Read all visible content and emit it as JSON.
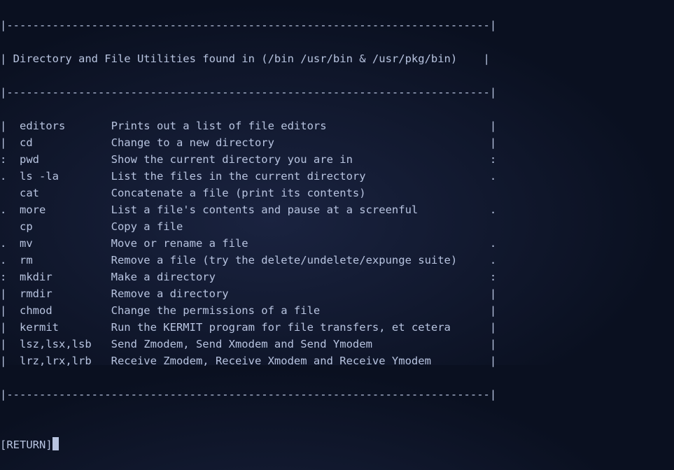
{
  "border_top": "|--------------------------------------------------------------------------|",
  "title_row": "| Directory and File Utilities found in (/bin /usr/bin & /usr/pkg/bin)    |",
  "border_mid": "|--------------------------------------------------------------------------|",
  "rows": [
    {
      "l": "|",
      "cmd": "editors",
      "desc": "Prints out a list of file editors",
      "r": "|"
    },
    {
      "l": "|",
      "cmd": "cd",
      "desc": "Change to a new directory",
      "r": "|"
    },
    {
      "l": ":",
      "cmd": "pwd",
      "desc": "Show the current directory you are in",
      "r": ":"
    },
    {
      "l": ".",
      "cmd": "ls -la",
      "desc": "List the files in the current directory",
      "r": "."
    },
    {
      "l": " ",
      "cmd": "cat",
      "desc": "Concatenate a file (print its contents)",
      "r": " "
    },
    {
      "l": ".",
      "cmd": "more",
      "desc": "List a file's contents and pause at a screenful",
      "r": "."
    },
    {
      "l": " ",
      "cmd": "cp",
      "desc": "Copy a file",
      "r": " "
    },
    {
      "l": ".",
      "cmd": "mv",
      "desc": "Move or rename a file",
      "r": "."
    },
    {
      "l": ".",
      "cmd": "rm",
      "desc": "Remove a file (try the delete/undelete/expunge suite)",
      "r": "."
    },
    {
      "l": ":",
      "cmd": "mkdir",
      "desc": "Make a directory",
      "r": ":"
    },
    {
      "l": "|",
      "cmd": "rmdir",
      "desc": "Remove a directory",
      "r": "|"
    },
    {
      "l": "|",
      "cmd": "chmod",
      "desc": "Change the permissions of a file",
      "r": "|"
    },
    {
      "l": "|",
      "cmd": "kermit",
      "desc": "Run the KERMIT program for file transfers, et cetera",
      "r": "|"
    },
    {
      "l": "|",
      "cmd": "lsz,lsx,lsb",
      "desc": "Send Zmodem, Send Xmodem and Send Ymodem",
      "r": "|"
    },
    {
      "l": "|",
      "cmd": "lrz,lrx,lrb",
      "desc": "Receive Zmodem, Receive Xmodem and Receive Ymodem",
      "r": "|"
    }
  ],
  "border_bot": "|--------------------------------------------------------------------------|",
  "prompt": "[RETURN]",
  "layout": {
    "cmd_col": 3,
    "desc_col": 17,
    "total_width": 76
  }
}
